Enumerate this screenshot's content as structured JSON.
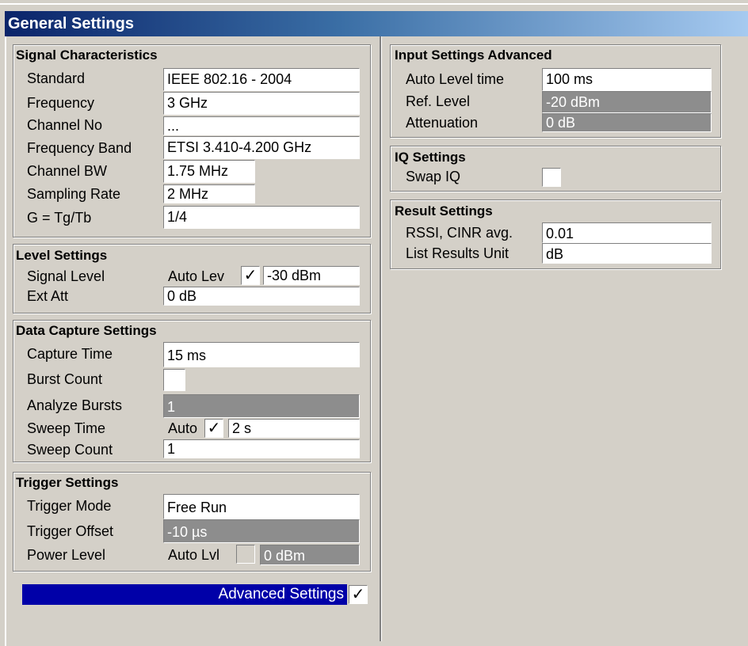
{
  "window": {
    "title": "General Settings"
  },
  "signal": {
    "title": "Signal Characteristics",
    "standard_label": "Standard",
    "standard_value": "IEEE 802.16 - 2004",
    "frequency_label": "Frequency",
    "frequency_value": "3 GHz",
    "channel_label": "Channel No",
    "channel_value": "...",
    "band_label": "Frequency Band",
    "band_value": "ETSI 3.410-4.200 GHz",
    "bw_label": "Channel BW",
    "bw_value": "1.75 MHz",
    "rate_label": "Sampling Rate",
    "rate_value": "2 MHz",
    "g_label": "G = Tg/Tb",
    "g_value": "1/4"
  },
  "level": {
    "title": "Level Settings",
    "signal_label": "Signal Level",
    "auto_label": "Auto Lev",
    "auto_check": "✓",
    "signal_value": "-30 dBm",
    "extatt_label": "Ext Att",
    "extatt_value": "0 dB"
  },
  "capture": {
    "title": "Data Capture Settings",
    "time_label": "Capture Time",
    "time_value": "15 ms",
    "burst_label": "Burst Count",
    "analyze_label": "Analyze Bursts",
    "analyze_value": "1",
    "sweep_time_label": "Sweep Time",
    "sweep_auto_label": "Auto",
    "sweep_auto_check": "✓",
    "sweep_time_value": "2 s",
    "sweep_count_label": "Sweep Count",
    "sweep_count_value": "1"
  },
  "trigger": {
    "title": "Trigger Settings",
    "mode_label": "Trigger Mode",
    "mode_value": "Free Run",
    "offset_label": "Trigger Offset",
    "offset_value": "-10 µs",
    "power_label": "Power Level",
    "power_auto_label": "Auto Lvl",
    "power_value": "0 dBm"
  },
  "advanced": {
    "label": "Advanced Settings",
    "check": "✓"
  },
  "input_adv": {
    "title": "Input Settings Advanced",
    "auto_time_label": "Auto Level time",
    "auto_time_value": "100 ms",
    "ref_label": "Ref. Level",
    "ref_value": "-20 dBm",
    "att_label": "Attenuation",
    "att_value": "0 dB"
  },
  "iq": {
    "title": "IQ Settings",
    "swap_label": "Swap IQ"
  },
  "result": {
    "title": "Result Settings",
    "rssi_label": "RSSI, CINR avg.",
    "rssi_value": "0.01",
    "unit_label": "List Results Unit",
    "unit_value": "dB"
  }
}
